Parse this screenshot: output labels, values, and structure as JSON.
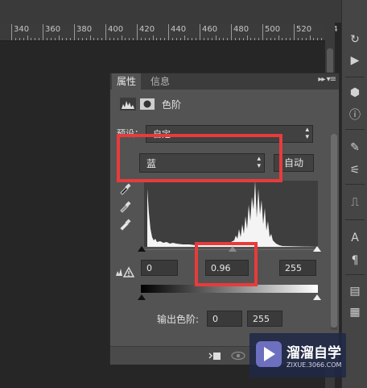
{
  "ruler": {
    "labels": [
      "340",
      "360",
      "380",
      "400",
      "420",
      "440",
      "460",
      "480",
      "500",
      "520",
      "54"
    ]
  },
  "tools": [
    "history-icon",
    "play-icon",
    "cube-icon",
    "info-icon",
    "brush-icon",
    "adjust-icon",
    "clone-stamp-icon",
    "character-icon",
    "paragraph-icon",
    "paragraph-style-icon",
    "char-style-icon"
  ],
  "panel": {
    "tabs": [
      "属性",
      "信息"
    ],
    "menu": "▸▸ ▾≡",
    "title": "色阶",
    "preset_label": "预设：",
    "preset_value": "自定",
    "channel_value": "蓝",
    "auto_button": "自动",
    "input_black": "0",
    "input_gamma": "0.96",
    "input_white": "255",
    "output_label": "输出色阶:",
    "output_black": "0",
    "output_white": "255"
  },
  "watermark": {
    "title": "溜溜自学",
    "url": "ZIXUE.3066.COM"
  },
  "colors": {
    "accent_highlight": "#e83b3b",
    "panel_bg": "#535353",
    "canvas": "#262626"
  }
}
